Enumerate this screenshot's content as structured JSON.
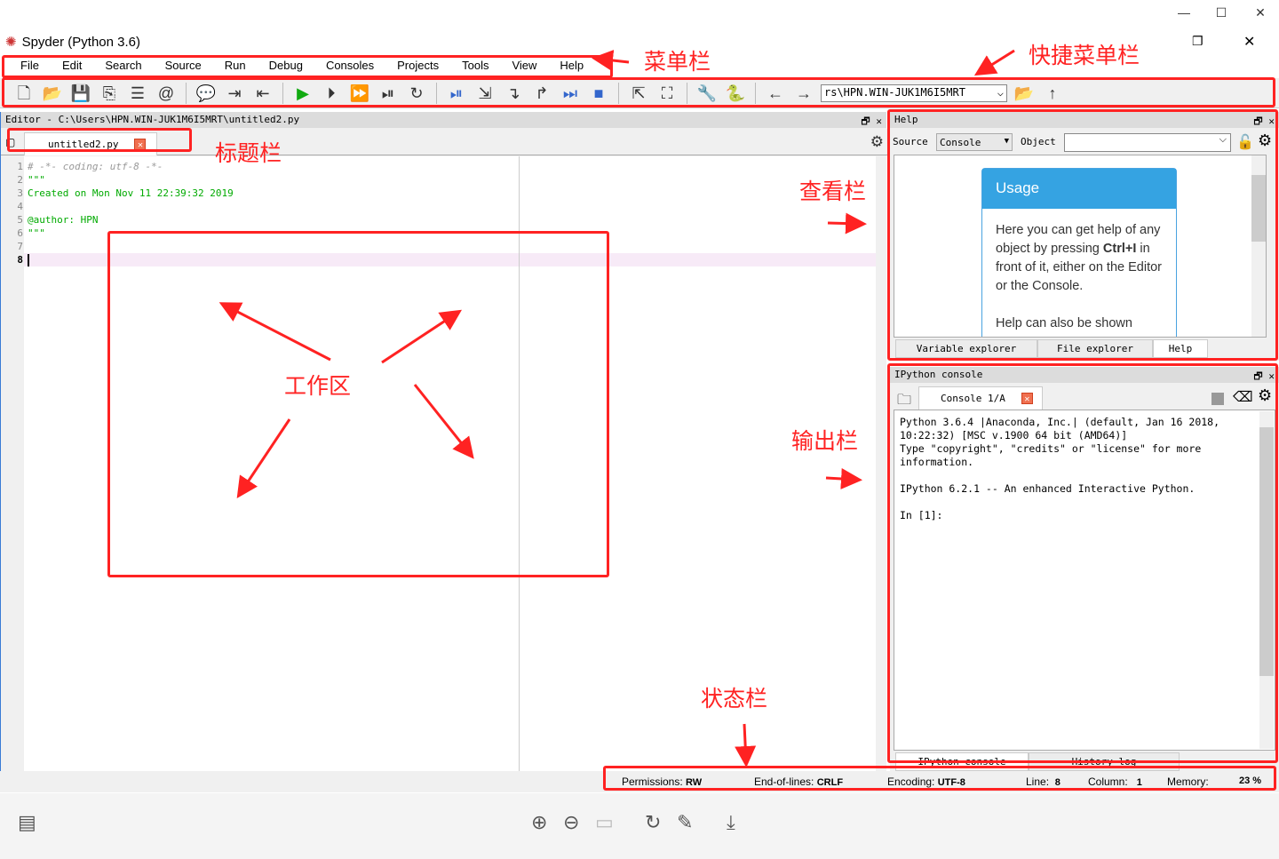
{
  "viewer": {
    "min": "—",
    "max": "☐",
    "close": "✕"
  },
  "app": {
    "title": "Spyder (Python 3.6)",
    "restore": "❐",
    "close": "✕"
  },
  "menu": [
    "File",
    "Edit",
    "Search",
    "Source",
    "Run",
    "Debug",
    "Consoles",
    "Projects",
    "Tools",
    "View",
    "Help"
  ],
  "toolbar": {
    "path": "rs\\HPN.WIN-JUK1M6I5MRT",
    "icons": [
      "new-file-icon",
      "open-file-icon",
      "save-icon",
      "save-all-icon",
      "list-icon",
      "at-icon",
      "comment-icon",
      "indent-icon",
      "unindent-icon",
      "run-icon",
      "run-cell-icon",
      "run-cell-advance-icon",
      "run-selection-icon",
      "rerun-icon",
      "debug-icon",
      "step-icon",
      "step-in-icon",
      "step-out-icon",
      "continue-icon",
      "stop-icon",
      "maximize-icon",
      "fullscreen-icon",
      "wrench-icon",
      "python-icon",
      "back-icon",
      "forward-icon",
      "folder-icon",
      "up-icon"
    ]
  },
  "editor": {
    "header": "Editor - C:\\Users\\HPN.WIN-JUK1M6I5MRT\\untitled2.py",
    "tab": "untitled2.py",
    "lines": [
      {
        "n": "1",
        "t": "# -*- coding: utf-8 -*-",
        "c": "#999"
      },
      {
        "n": "2",
        "t": "\"\"\"",
        "c": "#0a0"
      },
      {
        "n": "3",
        "t": "Created on Mon Nov 11 22:39:32 2019",
        "c": "#0a0"
      },
      {
        "n": "4",
        "t": "",
        "c": "#0a0"
      },
      {
        "n": "5",
        "t": "@author: HPN",
        "c": "#0a0"
      },
      {
        "n": "6",
        "t": "\"\"\"",
        "c": "#0a0"
      },
      {
        "n": "7",
        "t": "",
        "c": "#000"
      },
      {
        "n": "8",
        "t": "",
        "c": "#000"
      }
    ]
  },
  "help": {
    "header": "Help",
    "source_label": "Source",
    "source_value": "Console",
    "object_label": "Object",
    "usage_title": "Usage",
    "usage_p1a": "Here you can get help of any object by pressing ",
    "usage_bold": "Ctrl+I",
    "usage_p1b": " in front of it, either on the Editor or the Console.",
    "usage_p2": "Help can also be shown",
    "tabs": [
      "Variable explorer",
      "File explorer",
      "Help"
    ]
  },
  "console": {
    "header": "IPython console",
    "tab": "Console 1/A",
    "text": "Python 3.6.4 |Anaconda, Inc.| (default, Jan 16 2018,\n10:22:32) [MSC v.1900 64 bit (AMD64)]\nType \"copyright\", \"credits\" or \"license\" for more\ninformation.\n\nIPython 6.2.1 -- An enhanced Interactive Python.\n\nIn [1]:",
    "tabs": [
      "IPython console",
      "History log"
    ]
  },
  "status": {
    "perm_l": "Permissions:",
    "perm": "RW",
    "eol_l": "End-of-lines:",
    "eol": "CRLF",
    "enc_l": "Encoding:",
    "enc": "UTF-8",
    "line_l": "Line:",
    "line": "8",
    "col_l": "Column:",
    "col": "1",
    "mem_l": "Memory:",
    "mem": "23 %"
  },
  "annotations": {
    "menu": "菜单栏",
    "shortcut": "快捷菜单栏",
    "title": "标题栏",
    "view": "查看栏",
    "work": "工作区",
    "output": "输出栏",
    "status": "状态栏"
  },
  "colors": {
    "annotation": "#ff2222",
    "usage": "#35a3e2"
  }
}
